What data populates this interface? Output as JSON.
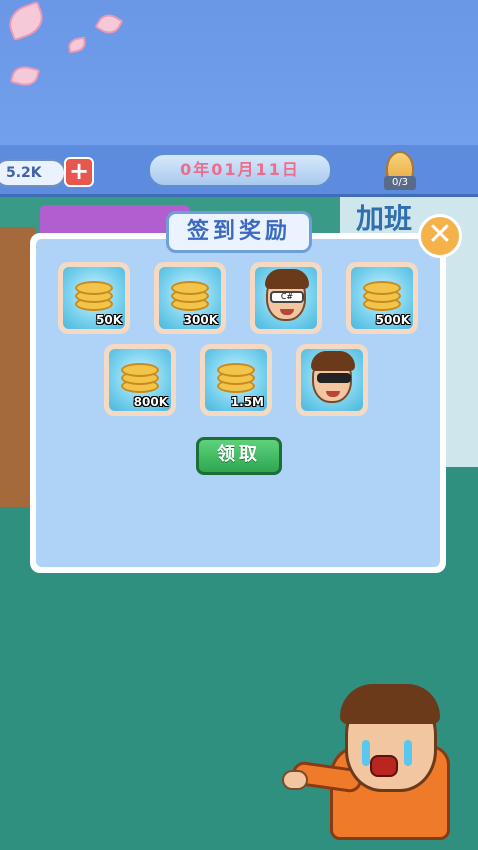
{
  "hud": {
    "money": "5.2K",
    "plus_symbol": "+",
    "date": "0年01月11日",
    "egg_count": "0/3"
  },
  "scene": {
    "sign_text": "加班"
  },
  "dialog": {
    "title": "签到奖励",
    "close_symbol": "✕",
    "claim_label": "领取",
    "rewards": [
      {
        "type": "coins",
        "amount": "50K"
      },
      {
        "type": "coins",
        "amount": "300K"
      },
      {
        "type": "character",
        "glasses_text": "C#"
      },
      {
        "type": "coins",
        "amount": "500K"
      },
      {
        "type": "coins",
        "amount": "800K"
      },
      {
        "type": "coins",
        "amount": "1.5M"
      },
      {
        "type": "character"
      }
    ]
  }
}
